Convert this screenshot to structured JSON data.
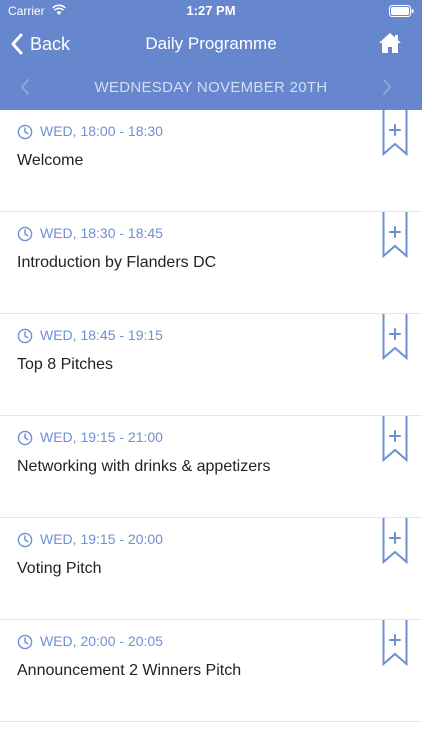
{
  "status_bar": {
    "carrier": "Carrier",
    "time": "1:27 PM"
  },
  "nav": {
    "back_label": "Back",
    "title": "Daily Programme"
  },
  "date_bar": {
    "label": "WEDNESDAY NOVEMBER 20TH"
  },
  "colors": {
    "header_bg": "#6687cd",
    "accent": "#6e8fd3"
  },
  "sessions": [
    {
      "time": "WED, 18:00 - 18:30",
      "title": "Welcome"
    },
    {
      "time": "WED, 18:30 - 18:45",
      "title": "Introduction by Flanders DC"
    },
    {
      "time": "WED, 18:45 - 19:15",
      "title": "Top 8 Pitches"
    },
    {
      "time": "WED, 19:15 - 21:00",
      "title": "Networking with drinks & appetizers"
    },
    {
      "time": "WED, 19:15 - 20:00",
      "title": "Voting Pitch"
    },
    {
      "time": "WED, 20:00 - 20:05",
      "title": "Announcement 2 Winners Pitch"
    }
  ]
}
